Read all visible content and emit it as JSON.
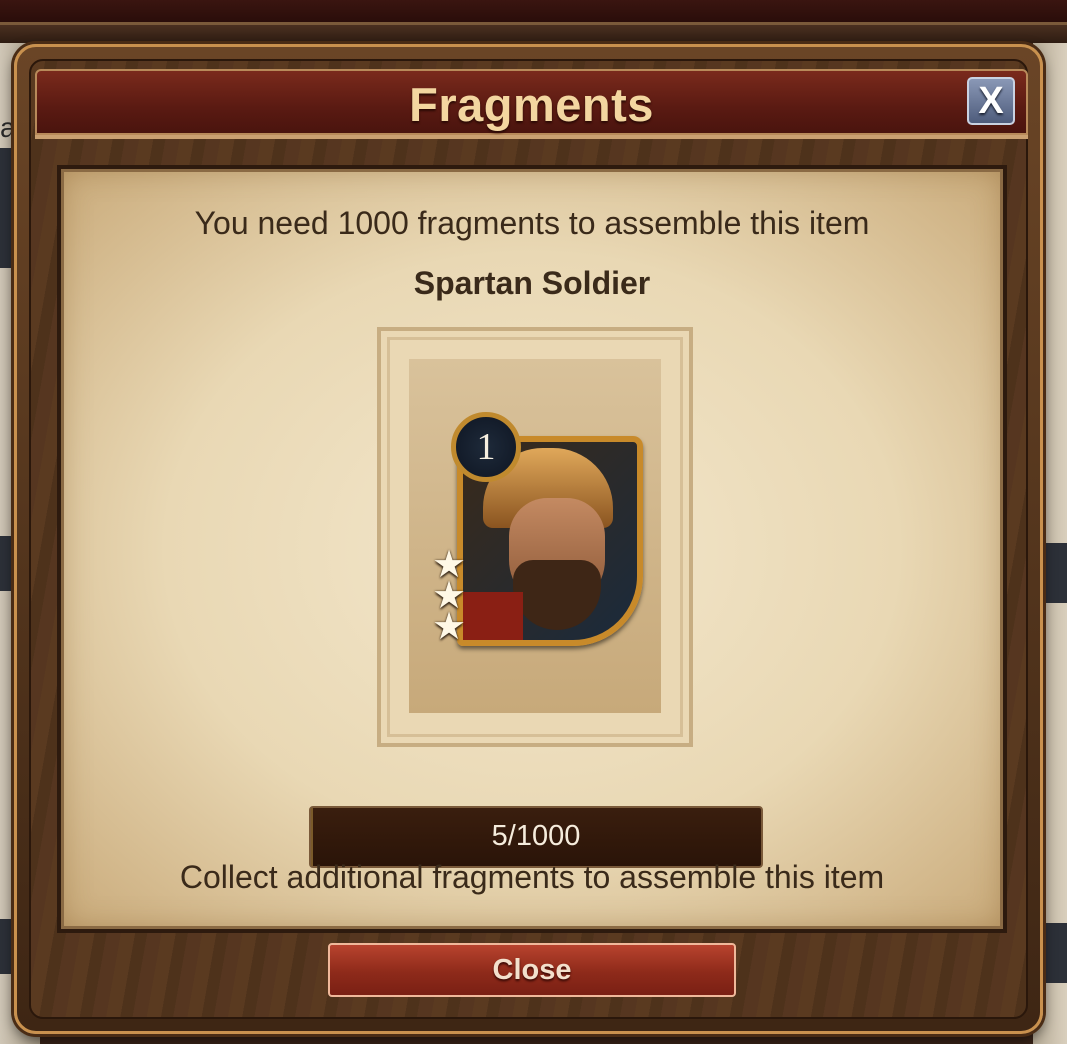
{
  "dialog": {
    "title": "Fragments",
    "close_x_label": "X",
    "need_text": "You need 1000 fragments to assemble this item",
    "item_name": "Spartan Soldier",
    "card": {
      "level": "1",
      "stars": 3
    },
    "progress": {
      "label": "5/1000",
      "current": 5,
      "total": 1000
    },
    "collect_text": "Collect additional fragments to assemble this item",
    "close_button_label": "Close"
  },
  "background": {
    "side_text": "a"
  },
  "icons": {
    "close": "close-icon",
    "star": "star-icon",
    "level": "level-badge"
  },
  "colors": {
    "title_text": "#f3d6a0",
    "title_bar": "#7a2a1c",
    "parchment": "#efe2c4",
    "button": "#9a3222",
    "close_x": "#6c7a9a"
  }
}
